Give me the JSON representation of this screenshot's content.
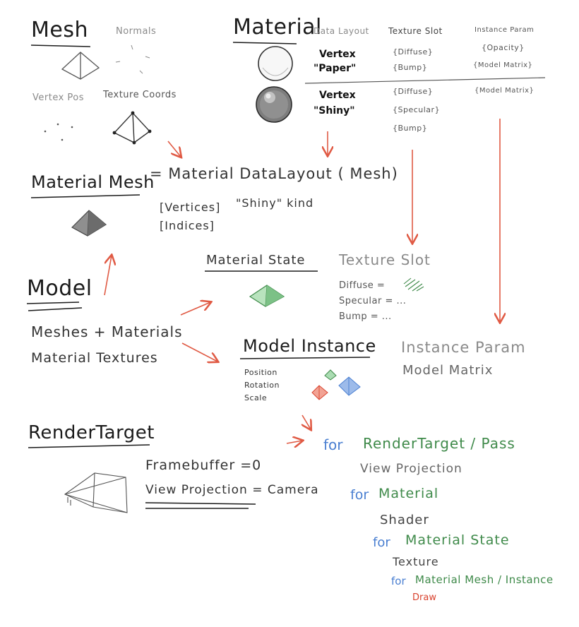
{
  "colors": {
    "arrow": "#e05a44",
    "blue": "#4a7fd1",
    "green": "#3f8a4a",
    "red": "#d9432f",
    "ink": "#1b1b1b"
  },
  "mesh": {
    "title": "Mesh",
    "normals": "Normals",
    "vertex_pos": "Vertex Pos",
    "texture_coords": "Texture Coords"
  },
  "material": {
    "title": "Material",
    "col_data_layout": "Data Layout",
    "col_texture_slot": "Texture Slot",
    "col_instance_param": "Instance Param",
    "rows": [
      {
        "layout_line1": "Vertex",
        "layout_line2": "\"Paper\"",
        "slots": [
          "{Diffuse}",
          "{Bump}"
        ],
        "params": [
          "{Opacity}",
          "{Model Matrix}"
        ]
      },
      {
        "layout_line1": "Vertex",
        "layout_line2": "\"Shiny\"",
        "slots": [
          "{Diffuse}",
          "{Specular}",
          "{Bump}"
        ],
        "params": [
          "{Model Matrix}"
        ]
      }
    ]
  },
  "material_mesh": {
    "title": "Material Mesh",
    "formula": "= Material DataLayout ( Mesh)",
    "vertices": "[Vertices]",
    "indices": "[Indices]",
    "kind": "\"Shiny\" kind"
  },
  "material_state": {
    "title": "Material State",
    "texture_slot": "Texture Slot",
    "diffuse": "Diffuse =",
    "specular": "Specular = ...",
    "bump": "Bump = ..."
  },
  "model": {
    "title": "Model",
    "line1": "Meshes + Materials",
    "line2": "Material Textures"
  },
  "model_instance": {
    "title": "Model Instance",
    "position": "Position",
    "rotation": "Rotation",
    "scale": "Scale",
    "instance_param": "Instance Param",
    "model_matrix": "Model Matrix"
  },
  "render_target": {
    "title": "RenderTarget",
    "framebuffer": "Framebuffer =0",
    "view_projection": "View Projection = Camera"
  },
  "loop": {
    "for1": "for",
    "render_target_pass": "RenderTarget / Pass",
    "view_projection": "View Projection",
    "for2": "for",
    "material": "Material",
    "shader": "Shader",
    "for3": "for",
    "material_state": "Material State",
    "texture": "Texture",
    "for4": "for",
    "material_mesh_instance": "Material Mesh / Instance",
    "draw": "Draw"
  }
}
